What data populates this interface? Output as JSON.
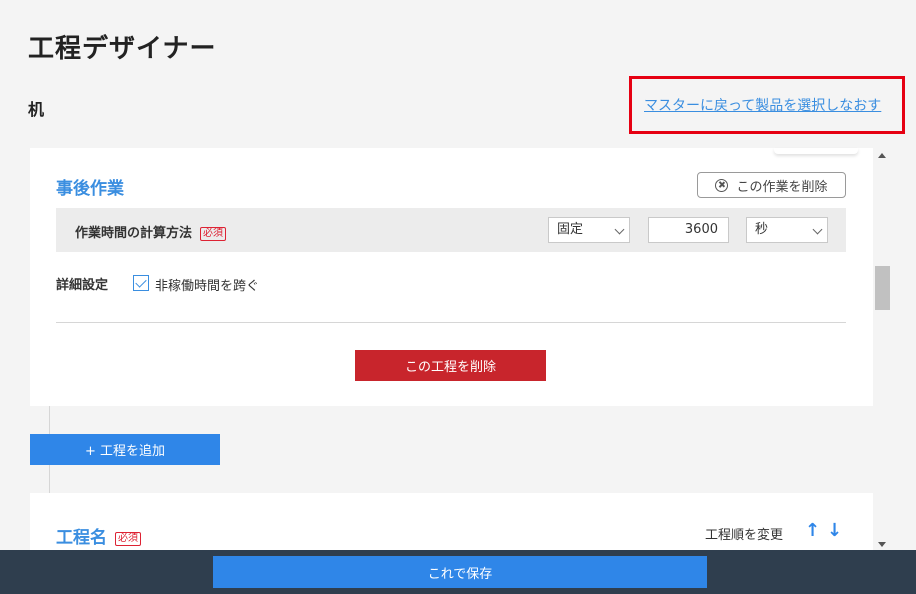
{
  "header": {
    "title": "工程デザイナー",
    "product_name": "机",
    "back_link": "マスターに戻って製品を選択しなおす"
  },
  "task_section": {
    "title": "事後作業",
    "delete_task_label": "この作業を削除",
    "time_calc_label": "作業時間の計算方法",
    "required_badge": "必須",
    "method_value": "固定",
    "duration_value": "3600",
    "unit_value": "秒",
    "detail_label": "詳細設定",
    "skip_nonworking_label": "非稼働時間を跨ぐ",
    "skip_nonworking_checked": true,
    "delete_process_label": "この工程を削除"
  },
  "add_process_label": "+ 工程を追加",
  "next_process": {
    "title": "工程名",
    "required_badge": "必須",
    "reorder_label": "工程順を変更",
    "up_arrow": "↑",
    "down_arrow": "↓"
  },
  "footer": {
    "save_label": "これで保存"
  },
  "colors": {
    "accent": "#2f86e8",
    "section_title": "#3a8ee0",
    "danger": "#c8252c",
    "footer_bg": "#2f3e4e",
    "highlight": "#e60012"
  },
  "icons": {
    "delete_task": "circle-x-icon",
    "checkbox": "checkmark-icon",
    "move_up": "arrow-up-icon",
    "move_down": "arrow-down-icon"
  }
}
